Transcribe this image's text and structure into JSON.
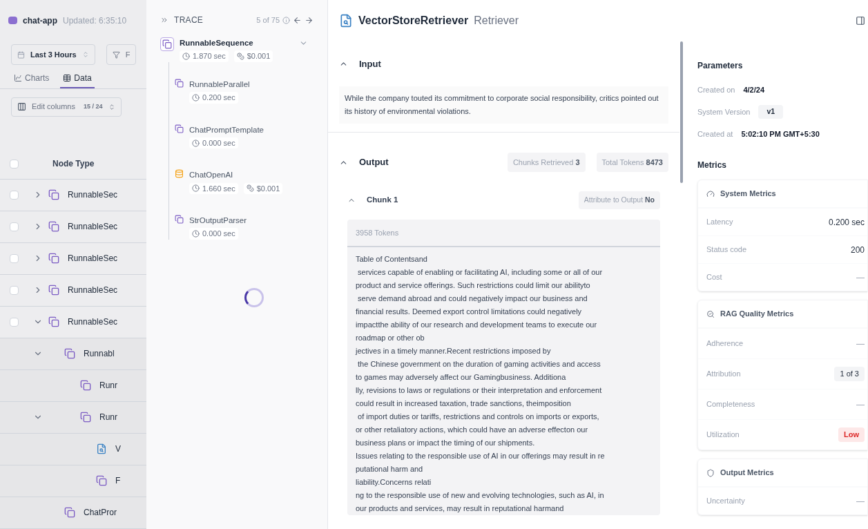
{
  "project": {
    "name": "chat-app",
    "updated": "Updated: 6:35:10"
  },
  "toolbar": {
    "time_range": "Last 3 Hours",
    "filter_label": "F"
  },
  "view_tabs": [
    {
      "label": "Charts",
      "kind": "chart",
      "selected": false
    },
    {
      "label": "Data",
      "kind": "table",
      "selected": true
    }
  ],
  "edit_columns": {
    "label": "Edit columns",
    "count": "15 / 24"
  },
  "table": {
    "columns": [
      "Node Type"
    ],
    "all_checked": false,
    "rows": [
      {
        "label": "RunnableSec",
        "kind": "chain",
        "checked": false,
        "expanded": false
      },
      {
        "label": "RunnableSec",
        "kind": "chain",
        "checked": false,
        "expanded": false
      },
      {
        "label": "RunnableSec",
        "kind": "chain",
        "checked": false,
        "expanded": false
      },
      {
        "label": "RunnableSec",
        "kind": "chain",
        "checked": false,
        "expanded": false
      },
      {
        "label": "RunnableSec",
        "kind": "chain",
        "checked": false,
        "expanded": true,
        "children": [
          {
            "label": "Runnabl",
            "kind": "chain",
            "expanded": true,
            "children": [
              {
                "label": "Runr",
                "kind": "chain"
              },
              {
                "label": "Runr",
                "kind": "chain",
                "expanded": true,
                "children": [
                  {
                    "label": "V",
                    "kind": "retriever"
                  },
                  {
                    "label": "F",
                    "kind": "chain"
                  }
                ]
              }
            ]
          },
          {
            "label": "ChatPror",
            "kind": "chain"
          }
        ]
      }
    ]
  },
  "trace": {
    "title": "TRACE",
    "position": "5 of 75",
    "nodes": [
      {
        "name": "RunnableSequence",
        "kind": "chain",
        "time": "1.870 sec",
        "cost": "$0.001",
        "expanded": true,
        "children": [
          {
            "name": "RunnableParallel",
            "kind": "chain",
            "time": "0.200 sec"
          },
          {
            "name": "ChatPromptTemplate",
            "kind": "chain",
            "time": "0.000 sec"
          },
          {
            "name": "ChatOpenAI",
            "kind": "llm",
            "time": "1.660 sec",
            "cost": "$0.001"
          },
          {
            "name": "StrOutputParser",
            "kind": "chain",
            "time": "0.000 sec"
          }
        ]
      }
    ]
  },
  "detail": {
    "title": "VectorStoreRetriever",
    "type": "Retriever",
    "input": {
      "heading": "Input",
      "expanded": true,
      "text": "While the company touted its commitment to corporate social responsibility, critics pointed out its history of environmental violations."
    },
    "output": {
      "heading": "Output",
      "expanded": true,
      "stats": [
        {
          "label": "Chunks Retrieved",
          "value": "3"
        },
        {
          "label": "Total Tokens",
          "value": "8473"
        }
      ],
      "chunk": {
        "title": "Chunk 1",
        "expanded": true,
        "attribute_label": "Attribute to Output",
        "attribute_value": "No",
        "tokens": "3958 Tokens",
        "lines": [
          "Table of Contentsand",
          " services capable of enabling or facilitating AI, including some or all of our",
          "product and service offerings. Such restrictions could limit our abilityto",
          " serve demand abroad and could negatively impact our business and",
          "financial results. Deemed export control limitations could negatively",
          "impactthe ability of our research and development teams to execute our",
          "roadmap or other ob",
          "jectives in a timely manner.Recent restrictions imposed by",
          " the Chinese government on the duration of gaming activities and access",
          "to games may adversely affect our Gamingbusiness. Additiona",
          "lly, revisions to laws or regulations or their interpretation and enforcement",
          "could result in increased taxation, trade sanctions, theimposition",
          " of import duties or tariffs, restrictions and controls on imports or exports,",
          "or other retaliatory actions, which could have an adverse effecton our",
          "business plans or impact the timing of our shipments.",
          "Issues relating to the responsible use of AI in our offerings may result in re",
          "putational harm and",
          "liability.Concerns relati",
          "ng to the responsible use of new and evolving technologies, such as AI, in",
          "our products and services, may result in reputational harmand"
        ]
      }
    }
  },
  "parameters": {
    "heading": "Parameters",
    "items": [
      {
        "label": "Created on",
        "value": "4/2/24",
        "kind": "plain"
      },
      {
        "label": "System Version",
        "value": "v1",
        "kind": "badge"
      },
      {
        "label": "Created at",
        "value": "5:02:10 PM GMT+5:30",
        "kind": "plain"
      }
    ]
  },
  "metrics": {
    "heading": "Metrics",
    "groups": [
      {
        "title": "System Metrics",
        "kind": "system",
        "rows": [
          {
            "label": "Latency",
            "value": "0.200 sec",
            "kind": "plain"
          },
          {
            "label": "Status code",
            "value": "200",
            "kind": "plain"
          },
          {
            "label": "Cost",
            "value": "—",
            "kind": "muted"
          }
        ]
      },
      {
        "title": "RAG Quality Metrics",
        "kind": "rag",
        "rows": [
          {
            "label": "Adherence",
            "value": "—",
            "kind": "muted"
          },
          {
            "label": "Attribution",
            "value": "1 of 3",
            "kind": "badge"
          },
          {
            "label": "Completeness",
            "value": "—",
            "kind": "muted"
          },
          {
            "label": "Utilization",
            "value": "Low",
            "kind": "alert"
          }
        ]
      },
      {
        "title": "Output Metrics",
        "kind": "output",
        "rows": [
          {
            "label": "Uncertainty",
            "value": "—",
            "kind": "muted"
          }
        ]
      }
    ]
  }
}
